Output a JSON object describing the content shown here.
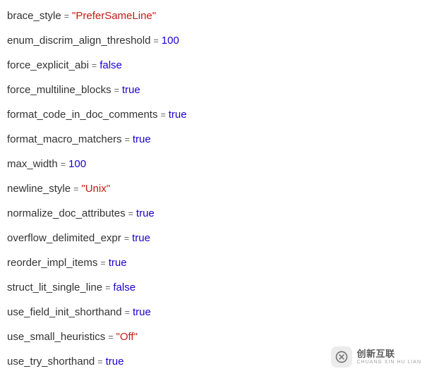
{
  "lines": [
    {
      "key": "brace_style",
      "value": "\"PreferSameLine\"",
      "type": "string"
    },
    {
      "key": "enum_discrim_align_threshold",
      "value": "100",
      "type": "number"
    },
    {
      "key": "force_explicit_abi",
      "value": "false",
      "type": "bool"
    },
    {
      "key": "force_multiline_blocks",
      "value": "true",
      "type": "bool"
    },
    {
      "key": "format_code_in_doc_comments",
      "value": "true",
      "type": "bool"
    },
    {
      "key": "format_macro_matchers",
      "value": "true",
      "type": "bool"
    },
    {
      "key": "max_width",
      "value": "100",
      "type": "number"
    },
    {
      "key": "newline_style",
      "value": "\"Unix\"",
      "type": "string"
    },
    {
      "key": "normalize_doc_attributes",
      "value": "true",
      "type": "bool"
    },
    {
      "key": "overflow_delimited_expr",
      "value": "true",
      "type": "bool"
    },
    {
      "key": "reorder_impl_items",
      "value": "true",
      "type": "bool"
    },
    {
      "key": "struct_lit_single_line",
      "value": "false",
      "type": "bool"
    },
    {
      "key": "use_field_init_shorthand",
      "value": "true",
      "type": "bool"
    },
    {
      "key": "use_small_heuristics",
      "value": "\"Off\"",
      "type": "string"
    },
    {
      "key": "use_try_shorthand",
      "value": "true",
      "type": "bool"
    }
  ],
  "equals": "=",
  "watermark": {
    "main": "创新互联",
    "sub": "CHUANG XIN HU LIAN"
  }
}
